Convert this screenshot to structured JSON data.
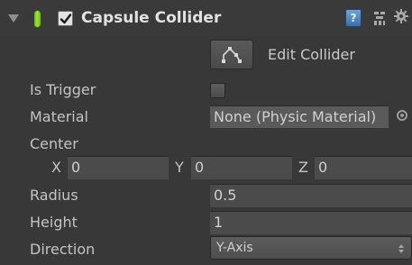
{
  "component": {
    "title": "Capsule Collider",
    "enabled": true,
    "icons": {
      "foldout": "foldout-arrow-icon",
      "type": "capsule-icon",
      "help": "help-book-icon",
      "presets": "presets-icon",
      "settings": "gear-icon"
    },
    "help_glyph": "?"
  },
  "edit_collider": {
    "label": "Edit Collider",
    "icon": "edit-collider-icon"
  },
  "properties": {
    "is_trigger": {
      "label": "Is Trigger",
      "checked": false
    },
    "material": {
      "label": "Material",
      "value": "None (Physic Material)"
    },
    "center": {
      "label": "Center",
      "x_label": "X",
      "x_value": "0",
      "y_label": "Y",
      "y_value": "0",
      "z_label": "Z",
      "z_value": "0"
    },
    "radius": {
      "label": "Radius",
      "value": "0.5"
    },
    "height": {
      "label": "Height",
      "value": "1"
    },
    "direction": {
      "label": "Direction",
      "value": "Y-Axis"
    }
  },
  "colors": {
    "panel_bg": "#383838",
    "field_bg": "#4b4b4b",
    "label_text": "#c4c4c4",
    "title_text": "#e2e2e2",
    "capsule_green": "#9ee43a"
  }
}
